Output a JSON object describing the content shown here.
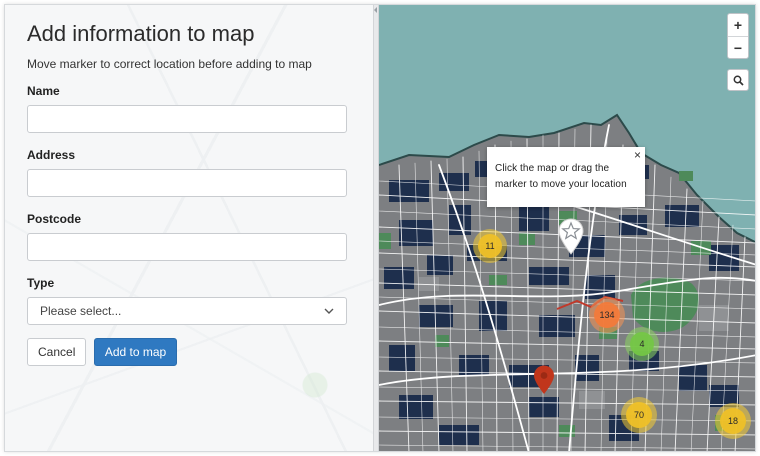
{
  "form": {
    "title": "Add information to map",
    "hint": "Move marker to correct location before adding to map",
    "fields": {
      "name": {
        "label": "Name",
        "value": ""
      },
      "address": {
        "label": "Address",
        "value": ""
      },
      "postcode": {
        "label": "Postcode",
        "value": ""
      },
      "type": {
        "label": "Type",
        "selected": "Please select..."
      }
    },
    "buttons": {
      "cancel": "Cancel",
      "add": "Add to map"
    }
  },
  "map": {
    "controls": {
      "zoom_in": "+",
      "zoom_out": "−",
      "search_icon": "search-icon"
    },
    "popup": {
      "text": "Click the map or drag the marker to move your location",
      "close": "×"
    },
    "clusters": [
      {
        "count": "11",
        "color": "yellow"
      },
      {
        "count": "134",
        "color": "orange"
      },
      {
        "count": "4",
        "color": "green"
      },
      {
        "count": "70",
        "color": "yellow"
      },
      {
        "count": "18",
        "color": "yellow"
      }
    ],
    "colors": {
      "sea": "#7fb1b1",
      "land": "#7d7f82",
      "buildings": "#1e2f4d",
      "parks": "#4e8a5a",
      "roads": "#ffffff",
      "marker_red": "#c1361c",
      "accent_button": "#2f79c1"
    }
  }
}
